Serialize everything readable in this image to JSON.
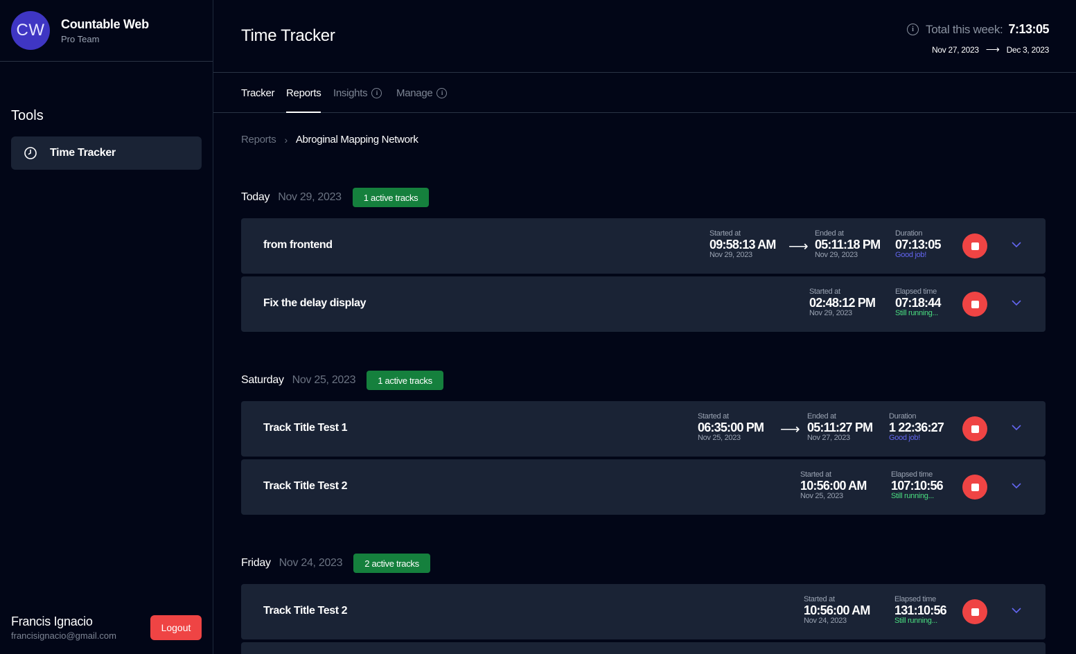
{
  "org": {
    "initials": "CW",
    "name": "Countable Web",
    "plan": "Pro Team"
  },
  "sidebar": {
    "section_title": "Tools",
    "items": [
      {
        "label": "Time Tracker",
        "icon": "clock-icon"
      }
    ]
  },
  "user": {
    "name": "Francis Ignacio",
    "email": "francisignacio@gmail.com",
    "logout_label": "Logout"
  },
  "header": {
    "title": "Time Tracker",
    "week_label": "Total this week:",
    "week_total": "7:13:05",
    "week_start": "Nov 27, 2023",
    "week_end": "Dec 3, 2023"
  },
  "tabs": [
    {
      "label": "Tracker",
      "active": true
    },
    {
      "label": "Reports",
      "active": true,
      "selected": true
    },
    {
      "label": "Insights",
      "active": false
    },
    {
      "label": "Manage",
      "active": false
    }
  ],
  "breadcrumb": {
    "root": "Reports",
    "current": "Abroginal Mapping Network"
  },
  "days": [
    {
      "name": "Today",
      "date": "Nov 29, 2023",
      "badge": "1 active tracks",
      "tracks": [
        {
          "title": "from frontend",
          "started_label": "Started at",
          "started_time": "09:58:13 AM",
          "started_date": "Nov 29, 2023",
          "ended_label": "Ended at",
          "ended_time": "05:11:18 PM",
          "ended_date": "Nov 29, 2023",
          "dur_label": "Duration",
          "dur_value": "07:13:05",
          "dur_note": "Good job!"
        },
        {
          "title": "Fix the delay display",
          "started_label": "Started at",
          "started_time": "02:48:12 PM",
          "started_date": "Nov 29, 2023",
          "dur_label": "Elapsed time",
          "dur_value": "07:18:44",
          "dur_note": "Still running..."
        }
      ]
    },
    {
      "name": "Saturday",
      "date": "Nov 25, 2023",
      "badge": "1 active tracks",
      "tracks": [
        {
          "title": "Track Title Test 1",
          "started_label": "Started at",
          "started_time": "06:35:00 PM",
          "started_date": "Nov 25, 2023",
          "ended_label": "Ended at",
          "ended_time": "05:11:27 PM",
          "ended_date": "Nov 27, 2023",
          "dur_label": "Duration",
          "dur_value": "1 22:36:27",
          "dur_note": "Good job!"
        },
        {
          "title": "Track Title Test 2",
          "started_label": "Started at",
          "started_time": "10:56:00 AM",
          "started_date": "Nov 25, 2023",
          "dur_label": "Elapsed time",
          "dur_value": "107:10:56",
          "dur_note": "Still running..."
        }
      ]
    },
    {
      "name": "Friday",
      "date": "Nov 24, 2023",
      "badge": "2 active tracks",
      "tracks": [
        {
          "title": "Track Title Test 2",
          "started_label": "Started at",
          "started_time": "10:56:00 AM",
          "started_date": "Nov 24, 2023",
          "dur_label": "Elapsed time",
          "dur_value": "131:10:56",
          "dur_note": "Still running..."
        }
      ]
    }
  ],
  "colors": {
    "badge": "#15803d",
    "stop": "#ef4444",
    "good": "#6366f1",
    "running": "#4ade80",
    "avatar": "#3f36c3"
  }
}
